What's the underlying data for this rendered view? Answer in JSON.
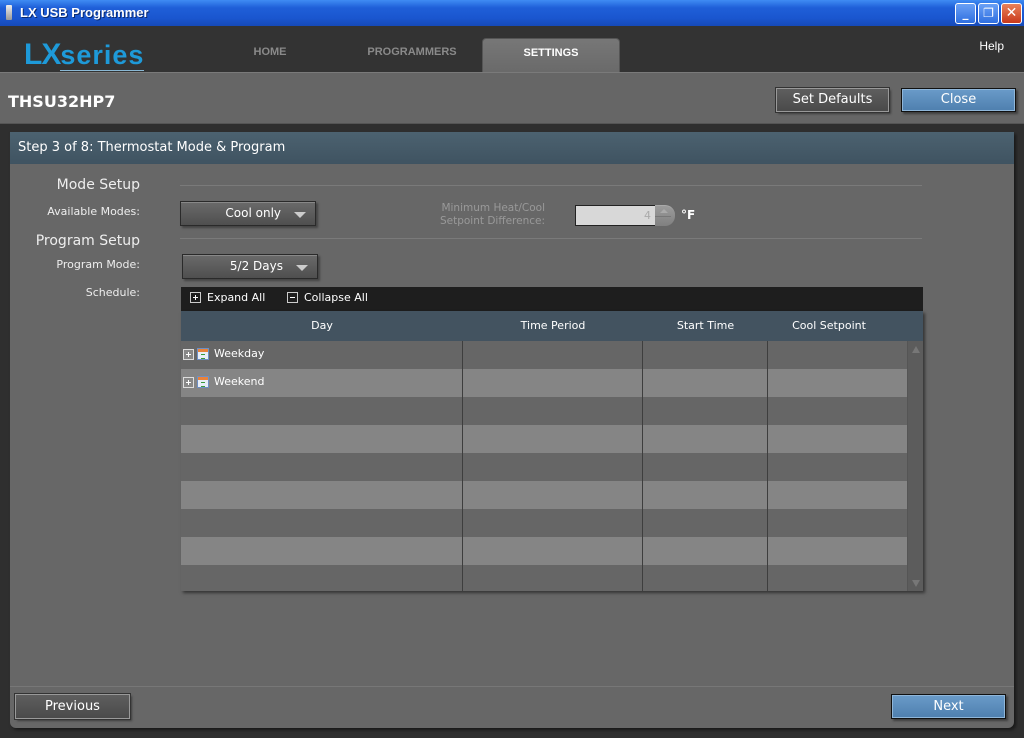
{
  "window": {
    "title": "LX USB Programmer",
    "controls": {
      "minimize": "_",
      "maximize": "❐",
      "close": "✕"
    }
  },
  "header": {
    "logo_prefix": "LX",
    "logo_suffix": "series",
    "nav": [
      {
        "label": "HOME",
        "active": false
      },
      {
        "label": "PROGRAMMERS",
        "active": false
      },
      {
        "label": "SETTINGS",
        "active": true
      }
    ],
    "help_label": "Help"
  },
  "device": {
    "name": "THSU32HP7",
    "set_defaults_label": "Set Defaults",
    "close_label": "Close"
  },
  "step": {
    "title": "Step 3 of 8: Thermostat Mode & Program"
  },
  "mode_setup": {
    "section_title": "Mode Setup",
    "available_modes_label": "Available Modes:",
    "available_modes_value": "Cool only",
    "min_diff_label_line1": "Minimum Heat/Cool",
    "min_diff_label_line2": "Setpoint Difference:",
    "min_diff_value": "4",
    "min_diff_unit": "°F"
  },
  "program_setup": {
    "section_title": "Program Setup",
    "program_mode_label": "Program Mode:",
    "program_mode_value": "5/2 Days",
    "schedule_label": "Schedule:",
    "expand_all_label": "Expand All",
    "collapse_all_label": "Collapse All",
    "columns": [
      "Day",
      "Time Period",
      "Start Time",
      "Cool Setpoint"
    ],
    "rows": [
      {
        "day": "Weekday",
        "time_period": "",
        "start_time": "",
        "cool_setpoint": ""
      },
      {
        "day": "Weekend",
        "time_period": "",
        "start_time": "",
        "cool_setpoint": ""
      }
    ]
  },
  "footer": {
    "previous_label": "Previous",
    "next_label": "Next"
  },
  "colors": {
    "accent_blue": "#5a8cbc",
    "logo_blue": "#1e9ad9",
    "header_bg": "#333333",
    "step_header_bg": "#435360"
  }
}
